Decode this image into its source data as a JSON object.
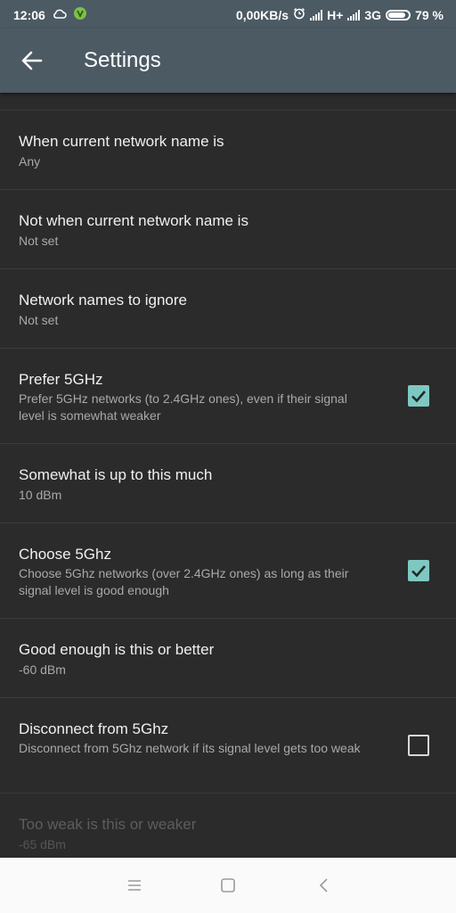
{
  "status_bar": {
    "time": "12:06",
    "network_speed": "0,00KB/s",
    "network_type_1": "H+",
    "network_type_2": "3G",
    "battery": "79 %"
  },
  "app_bar": {
    "title": "Settings",
    "back_icon": "arrow-left-icon"
  },
  "settings": [
    {
      "title": "When current network name is",
      "summary": "Any"
    },
    {
      "title": "Not when current network name is",
      "summary": "Not set"
    },
    {
      "title": "Network names to ignore",
      "summary": "Not set"
    },
    {
      "title": "Prefer 5GHz",
      "summary": "Prefer 5GHz networks (to 2.4GHz ones), even if their signal level is somewhat weaker",
      "checked": true
    },
    {
      "title": "Somewhat is up to this much",
      "summary": "10 dBm"
    },
    {
      "title": "Choose 5Ghz",
      "summary": "Choose 5Ghz networks (over 2.4GHz ones) as long as their signal level is good enough",
      "checked": true
    },
    {
      "title": "Good enough is this or better",
      "summary": "-60 dBm"
    },
    {
      "title": "Disconnect from 5Ghz",
      "summary": "Disconnect from 5Ghz network if its signal level gets too weak",
      "checked": false
    },
    {
      "title": "Too weak is this or weaker",
      "summary": "-65 dBm",
      "enabled": false
    }
  ],
  "nav_bar": {
    "icons": [
      "menu-icon",
      "home-square-icon",
      "back-chevron-icon"
    ]
  },
  "colors": {
    "app_bar": "#4c5a64",
    "background": "#2b2b2b",
    "checkbox_accent": "#7fc8c2",
    "divider": "#3b3b3b"
  }
}
